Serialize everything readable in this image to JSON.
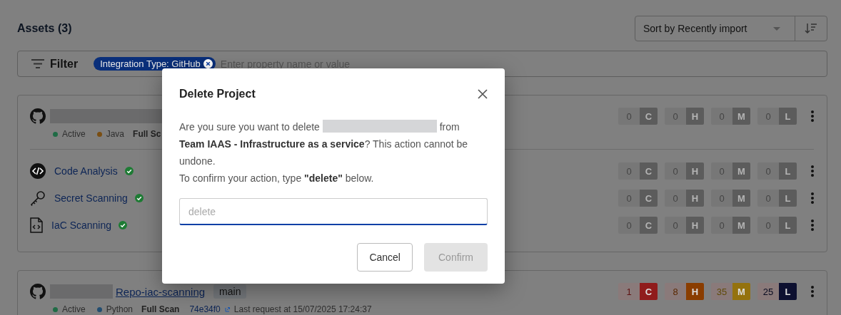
{
  "header": {
    "title": "Assets (3)",
    "sort": {
      "value": "Sort by Recently import"
    }
  },
  "filter": {
    "label": "Filter",
    "chips": [
      {
        "label": "Integration Type: GitHub"
      }
    ],
    "placeholder": "Enter property name or value"
  },
  "projects": [
    {
      "meta": [
        {
          "kind": "status",
          "label": "Active",
          "color": "#1f6b45"
        },
        {
          "kind": "language",
          "label": "Java",
          "color": "#7a4e12"
        },
        {
          "kind": "bold",
          "label": "Full Sc"
        }
      ],
      "severity": [
        {
          "count": "0",
          "letter": "C",
          "active": false
        },
        {
          "count": "0",
          "letter": "H",
          "active": false
        },
        {
          "count": "0",
          "letter": "M",
          "active": false
        },
        {
          "count": "0",
          "letter": "L",
          "active": false
        }
      ],
      "scans": [
        {
          "kind": "code",
          "name": "Code Analysis",
          "ok": true,
          "severity": [
            {
              "count": "0",
              "letter": "C",
              "active": false
            },
            {
              "count": "0",
              "letter": "H",
              "active": false
            },
            {
              "count": "0",
              "letter": "M",
              "active": false
            },
            {
              "count": "0",
              "letter": "L",
              "active": false
            }
          ]
        },
        {
          "kind": "key",
          "name": "Secret Scanning",
          "ok": true,
          "severity": [
            {
              "count": "0",
              "letter": "C",
              "active": false
            },
            {
              "count": "0",
              "letter": "H",
              "active": false
            },
            {
              "count": "0",
              "letter": "M",
              "active": false
            },
            {
              "count": "0",
              "letter": "L",
              "active": false
            }
          ]
        },
        {
          "kind": "file",
          "name": "IaC Scanning",
          "ok": true,
          "severity": [
            {
              "count": "0",
              "letter": "C",
              "active": false
            },
            {
              "count": "0",
              "letter": "H",
              "active": false
            },
            {
              "count": "0",
              "letter": "M",
              "active": false
            },
            {
              "count": "0",
              "letter": "L",
              "active": false
            }
          ]
        }
      ]
    },
    {
      "name": "Repo-iac-scanning",
      "branch": "main",
      "meta": [
        {
          "kind": "status",
          "label": "Active",
          "color": "#1f6b45"
        },
        {
          "kind": "language",
          "label": "Python",
          "color": "#224d70"
        },
        {
          "kind": "bold",
          "label": "Full Scan"
        },
        {
          "kind": "commit",
          "label": "74e34f0"
        },
        {
          "kind": "plain",
          "label": "Last request at 15/07/2025 17:24:37"
        }
      ],
      "severity": [
        {
          "count": "1",
          "letter": "C",
          "active": true,
          "color": "#901c1c"
        },
        {
          "count": "8",
          "letter": "H",
          "active": true,
          "color": "#8a3d00"
        },
        {
          "count": "35",
          "letter": "M",
          "active": true,
          "color": "#94720e"
        },
        {
          "count": "25",
          "letter": "L",
          "active": true,
          "color": "#0d1030"
        }
      ]
    }
  ],
  "dialog": {
    "title": "Delete Project",
    "message_before": "Are you sure you want to delete",
    "message_after": "from **Team IAAS - Infrastructure as a service**? This action cannot be undone.",
    "instruction": "To confirm your action, type **\"delete\"** below.",
    "placeholder": "delete",
    "cancel": "Cancel",
    "confirm": "Confirm",
    "confirm_disabled": true
  }
}
